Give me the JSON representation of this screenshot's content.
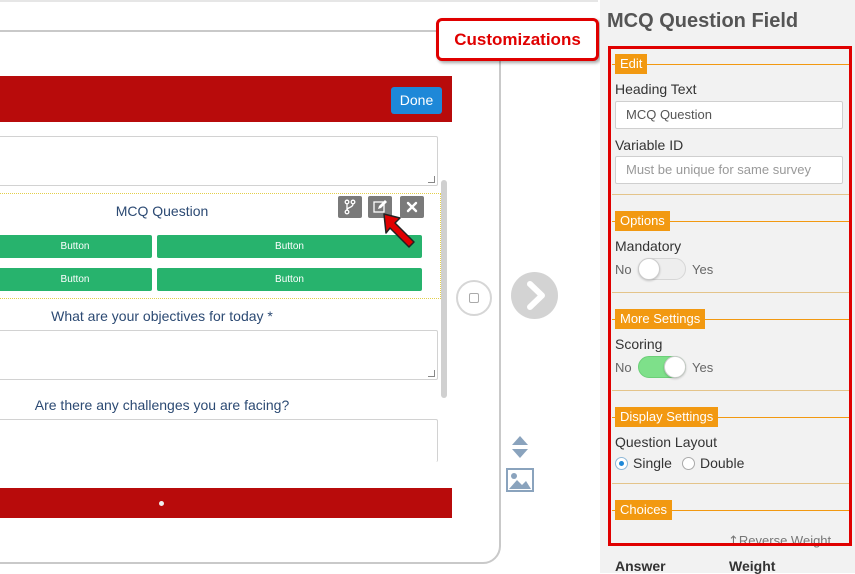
{
  "survey": {
    "done_label": "Done",
    "mcq_title": "MCQ Question",
    "buttons": [
      "Button",
      "Button",
      "Button",
      "Button"
    ],
    "question_2": "What are your objectives for today *",
    "question_3": "Are there any challenges you are facing?"
  },
  "callout": {
    "text": "Customizations"
  },
  "panel": {
    "title": "MCQ Question Field",
    "edit": {
      "tag": "Edit",
      "heading_label": "Heading Text",
      "heading_value": "MCQ Question",
      "variable_label": "Variable ID",
      "variable_placeholder": "Must be unique for same survey"
    },
    "options": {
      "tag": "Options",
      "mandatory_label": "Mandatory",
      "no": "No",
      "yes": "Yes",
      "mandatory_on": false
    },
    "more_settings": {
      "tag": "More Settings",
      "scoring_label": "Scoring",
      "no": "No",
      "yes": "Yes",
      "scoring_on": true
    },
    "display_settings": {
      "tag": "Display Settings",
      "layout_label": "Question Layout",
      "single": "Single",
      "double": "Double",
      "selected": "Single"
    },
    "choices": {
      "tag": "Choices",
      "reverse_weight": "Reverse Weight",
      "col_answer": "Answer",
      "col_weight": "Weight"
    }
  },
  "colors": {
    "header_red": "#b80b0b",
    "done_blue": "#1e88d8",
    "button_green": "#27b36d",
    "section_orange": "#f29911",
    "highlight_red": "#e00000",
    "toggle_on": "#7ee08a"
  }
}
